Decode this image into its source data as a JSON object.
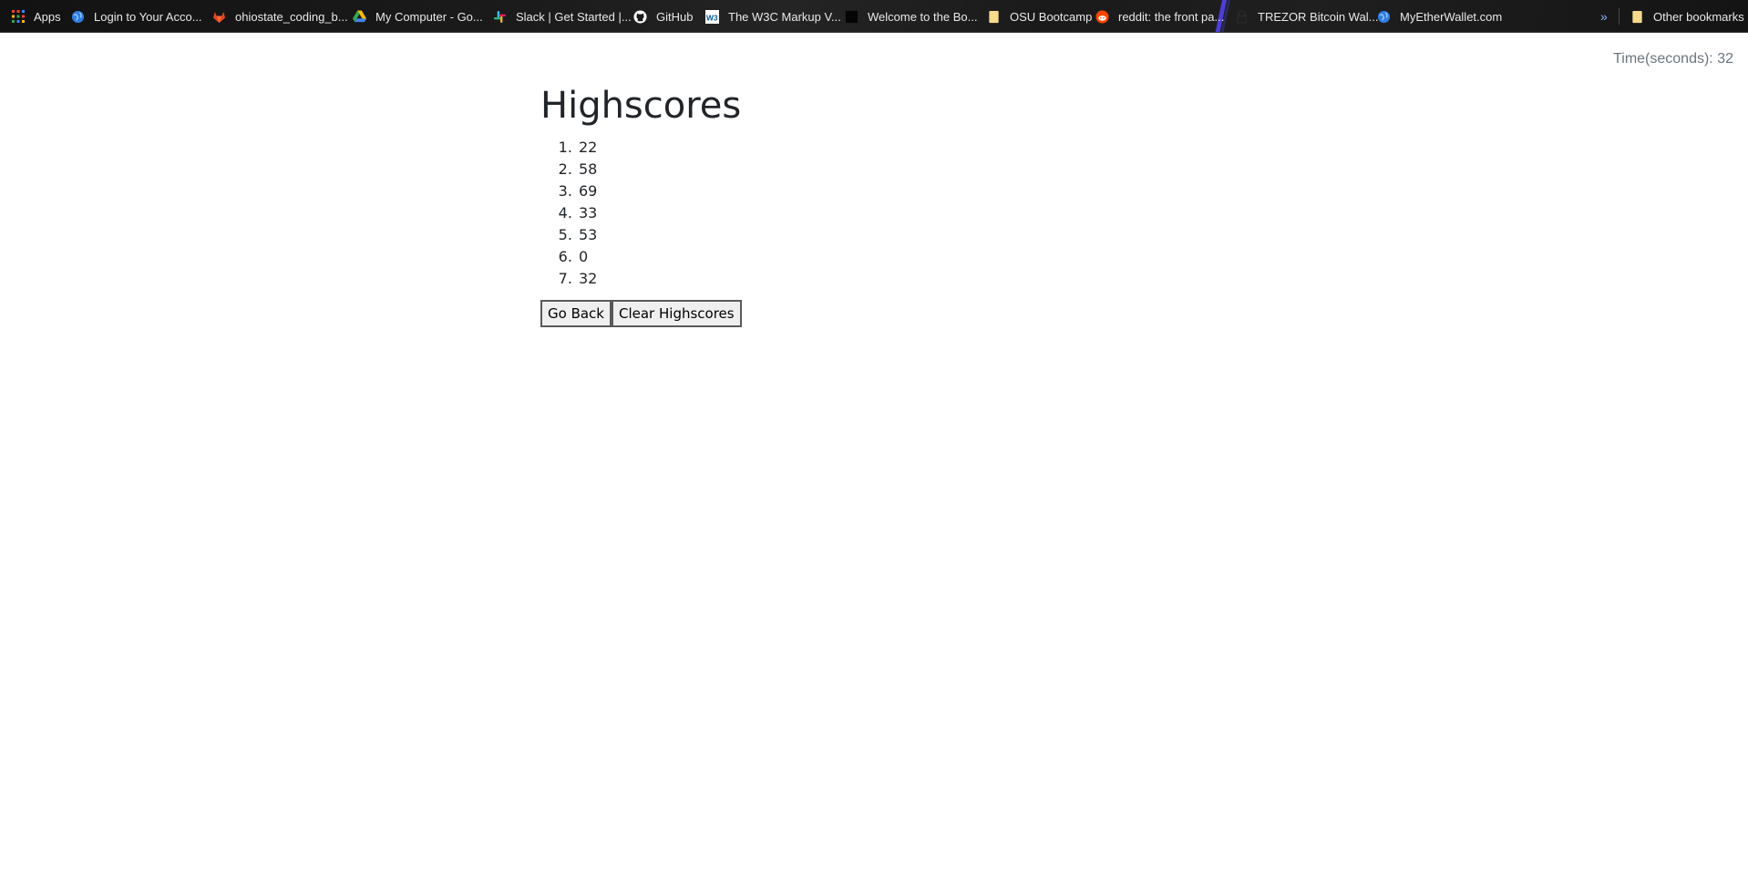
{
  "bookmarks": [
    {
      "label": "Apps",
      "icon": "apps-grid-icon"
    },
    {
      "label": "Login to Your Acco...",
      "icon": "globe-icon"
    },
    {
      "label": "ohiostate_coding_b...",
      "icon": "gitlab-icon"
    },
    {
      "label": "My Computer - Go...",
      "icon": "google-drive-icon"
    },
    {
      "label": "Slack | Get Started |...",
      "icon": "slack-icon"
    },
    {
      "label": "GitHub",
      "icon": "github-icon"
    },
    {
      "label": "The W3C Markup V...",
      "icon": "w3c-icon"
    },
    {
      "label": "Welcome to the Bo...",
      "icon": "dark-page-icon"
    },
    {
      "label": "OSU Bootcamp",
      "icon": "folder-icon"
    },
    {
      "label": "reddit: the front pa...",
      "icon": "reddit-icon"
    },
    {
      "label": "TREZOR Bitcoin Wal...",
      "icon": "lock-icon"
    },
    {
      "label": "MyEtherWallet.com",
      "icon": "globe-icon"
    }
  ],
  "overflow_label": "»",
  "other_bookmarks": {
    "label": "Other bookmarks",
    "icon": "folder-icon"
  },
  "timer": {
    "text": "Time(seconds): 32"
  },
  "highscores": {
    "title": "Highscores",
    "scores": [
      "22",
      "58",
      "69",
      "33",
      "53",
      "0",
      "32"
    ]
  },
  "buttons": {
    "go_back": "Go Back",
    "clear": "Clear Highscores"
  },
  "colors": {
    "bar_background": "#1a1a1a",
    "bar_text": "#e8e8e8",
    "heading": "#212529",
    "timer_text": "#6c757d",
    "button_bg": "#efefef"
  }
}
